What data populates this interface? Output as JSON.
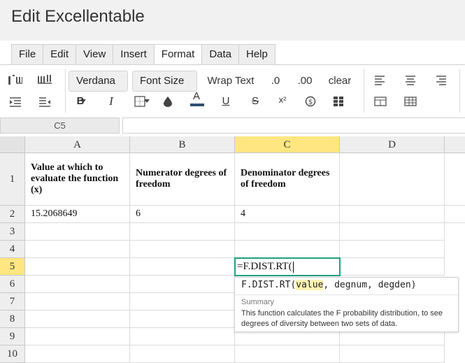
{
  "app": {
    "title": "Edit Excellentable"
  },
  "menu": [
    "File",
    "Edit",
    "View",
    "Insert",
    "Format",
    "Data",
    "Help"
  ],
  "menu_active": "Format",
  "toolbar": {
    "font_family": "Verdana",
    "font_size": "Font Size",
    "wrap_text": "Wrap Text",
    "decimal_decrease": ".0",
    "decimal_increase": ".00",
    "clear": "clear",
    "bold": "B",
    "italic": "I",
    "text_color_letter": "A",
    "underline": "U",
    "strikethrough": "S",
    "superscript": "x²"
  },
  "name_box": "C5",
  "formula_bar": "",
  "columns": [
    "A",
    "B",
    "C",
    "D"
  ],
  "active_column": "C",
  "rows": [
    "1",
    "2",
    "3",
    "4",
    "5",
    "6",
    "7",
    "8",
    "9",
    "10"
  ],
  "active_row": "5",
  "cells": {
    "A1": "Value at which to evaluate the function (x)",
    "B1": "Numerator degrees of freedom",
    "C1": "Denominator degrees of freedom",
    "A2": "15.2068649",
    "B2": "6",
    "C2": "4"
  },
  "editing_cell": {
    "ref": "C5",
    "value": "=F.DIST.RT("
  },
  "tooltip": {
    "fn": "F.DIST.RT(",
    "arg_active": "value",
    "args_rest": ", degnum, degden)",
    "summary_label": "Summary",
    "summary": "This function calculates the F probability distribution, to see degrees of diversity between two sets of data."
  },
  "colors": {
    "active_header": "#ffe680",
    "edit_border": "#1fa080",
    "accent": "#2f4f6f"
  }
}
